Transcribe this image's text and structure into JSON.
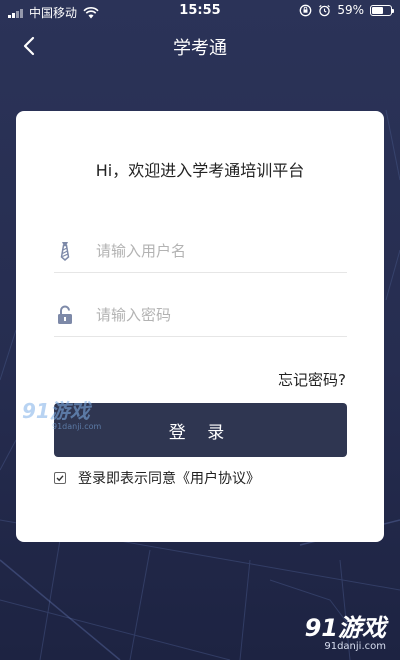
{
  "status_bar": {
    "carrier": "中国移动",
    "time": "15:55",
    "battery_percent": "59%",
    "battery_level": 0.59
  },
  "navbar": {
    "title": "学考通",
    "back_icon": "chevron-left-icon"
  },
  "login_card": {
    "welcome": "Hi，欢迎进入学考通培训平台",
    "username_placeholder": "请输入用户名",
    "password_placeholder": "请输入密码",
    "forgot_password": "忘记密码?",
    "login_button": "登 录",
    "agreement_text": "登录即表示同意",
    "agreement_link": "《用户协议》",
    "agreement_checked": true
  },
  "watermarks": {
    "small_logo": "91游戏",
    "small_url": "91danji.com",
    "big_logo": "91游戏",
    "big_url": "91danji.com"
  },
  "colors": {
    "background": "#262d50",
    "card": "#ffffff",
    "button": "#2f3651"
  }
}
